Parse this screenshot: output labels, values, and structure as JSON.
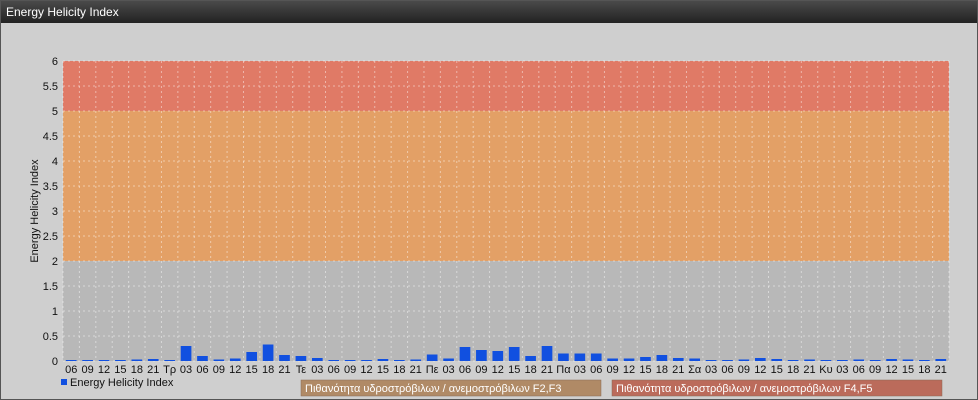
{
  "window": {
    "title": "Energy Helicity Index"
  },
  "colors": {
    "band_low": "#b8b8b8",
    "band_mid": "#e3a066",
    "band_high": "#e07a66",
    "bar": "#1150e0",
    "label_box_1": "#b08a66",
    "label_box_2": "#bb6b5b"
  },
  "chart_data": {
    "type": "bar",
    "ylabel": "Energy Helicity Index",
    "ylim": [
      0,
      6
    ],
    "yticks": [
      "0",
      "0.5",
      "1",
      "1.5",
      "2",
      "2.5",
      "3",
      "3.5",
      "4",
      "4.5",
      "5",
      "5.5",
      "6"
    ],
    "legend": "Energy Helicity Index",
    "bands": [
      {
        "from": 0,
        "to": 2,
        "color": "#b8b8b8"
      },
      {
        "from": 2,
        "to": 5,
        "color": "#e3a066"
      },
      {
        "from": 5,
        "to": 6,
        "color": "#e07a66"
      }
    ],
    "band_labels": [
      "Πιθανότητα υδροστρόβιλων / ανεμοστρόβιλων F2,F3",
      "Πιθανότητα υδροστρόβιλων / ανεμοστρόβιλων F4,F5"
    ],
    "categories": [
      "06",
      "09",
      "12",
      "15",
      "18",
      "21",
      "Τρ",
      "03",
      "06",
      "09",
      "12",
      "15",
      "18",
      "21",
      "Τε",
      "03",
      "06",
      "09",
      "12",
      "15",
      "18",
      "21",
      "Πε",
      "03",
      "06",
      "09",
      "12",
      "15",
      "18",
      "21",
      "Πα",
      "03",
      "06",
      "09",
      "12",
      "15",
      "18",
      "21",
      "Σα",
      "03",
      "06",
      "09",
      "12",
      "15",
      "18",
      "21",
      "Κυ",
      "03",
      "06",
      "09",
      "12",
      "15",
      "18",
      "21"
    ],
    "values": [
      0.02,
      0.02,
      0.02,
      0.02,
      0.03,
      0.04,
      0.02,
      0.3,
      0.1,
      0.03,
      0.05,
      0.18,
      0.33,
      0.12,
      0.1,
      0.06,
      0.02,
      0.02,
      0.02,
      0.04,
      0.02,
      0.03,
      0.13,
      0.05,
      0.28,
      0.22,
      0.2,
      0.28,
      0.1,
      0.3,
      0.15,
      0.15,
      0.15,
      0.05,
      0.05,
      0.08,
      0.12,
      0.06,
      0.05,
      0.02,
      0.02,
      0.03,
      0.06,
      0.04,
      0.02,
      0.03,
      0.02,
      0.02,
      0.03,
      0.02,
      0.04,
      0.03,
      0.02,
      0.04
    ]
  }
}
